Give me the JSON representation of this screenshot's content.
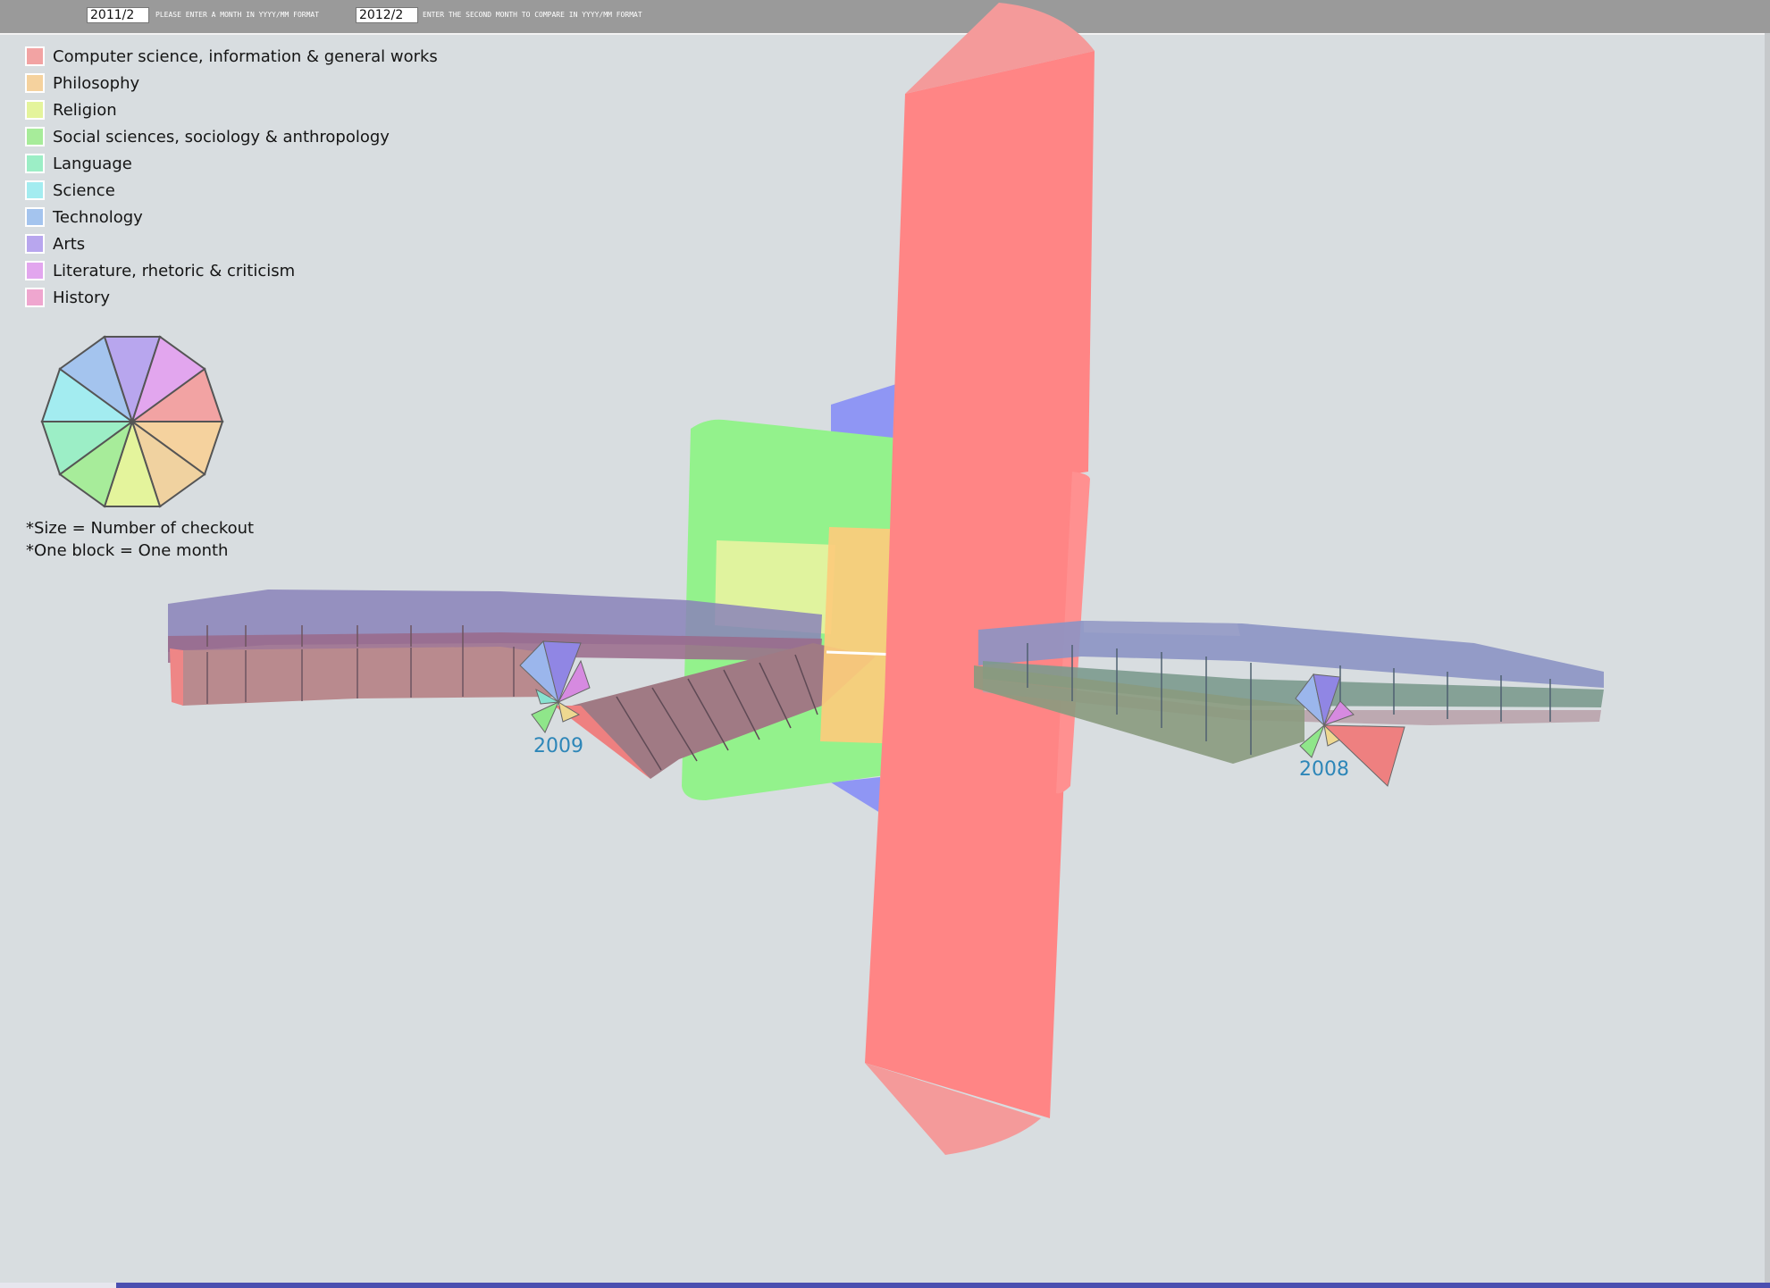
{
  "inputs": {
    "first_month": {
      "value": "2011/2",
      "hint": "PLEASE ENTER A MONTH IN YYYY/MM FORMAT"
    },
    "second_month": {
      "value": "2012/2",
      "hint": "ENTER THE SECOND MONTH TO COMPARE IN YYYY/MM FORMAT"
    }
  },
  "legend": [
    {
      "label": "Computer science, information & general works",
      "color": "#f2a3a3"
    },
    {
      "label": "Philosophy",
      "color": "#f5d29e"
    },
    {
      "label": "Religion",
      "color": "#e4f49c"
    },
    {
      "label": "Social sciences, sociology & anthropology",
      "color": "#a7ec9a"
    },
    {
      "label": "Language",
      "color": "#9ceec6"
    },
    {
      "label": "Science",
      "color": "#a3ecf0"
    },
    {
      "label": "Technology",
      "color": "#a4c4ee"
    },
    {
      "label": "Arts",
      "color": "#b8a6ee"
    },
    {
      "label": "Literature, rhetoric & criticism",
      "color": "#e2a6ee"
    },
    {
      "label": "History",
      "color": "#efa6cf"
    }
  ],
  "notes": {
    "size": "*Size = Number of checkout",
    "block": "*One block = One month"
  },
  "scene": {
    "year_left": "2009",
    "year_right": "2008"
  }
}
